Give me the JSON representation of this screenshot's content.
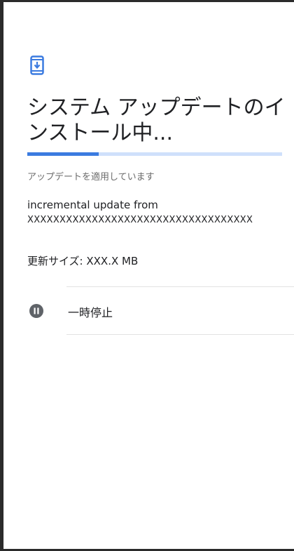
{
  "screen": {
    "icon": "system-update-icon",
    "title": "システム アップデートのインストール中...",
    "progress": 0.28,
    "status_text": "アップデートを適用しています",
    "update_description": "incremental update from",
    "update_id": "XXXXXXXXXXXXXXXXXXXXXXXXXXXXXXXXXXX",
    "size_text": "更新サイズ: XXX.X MB"
  },
  "actions": {
    "pause_icon": "pause-icon",
    "pause_label": "一時停止"
  },
  "colors": {
    "accent": "#3b7be0",
    "progress_track": "#cfe0fb",
    "icon_gray": "#5f6368"
  }
}
